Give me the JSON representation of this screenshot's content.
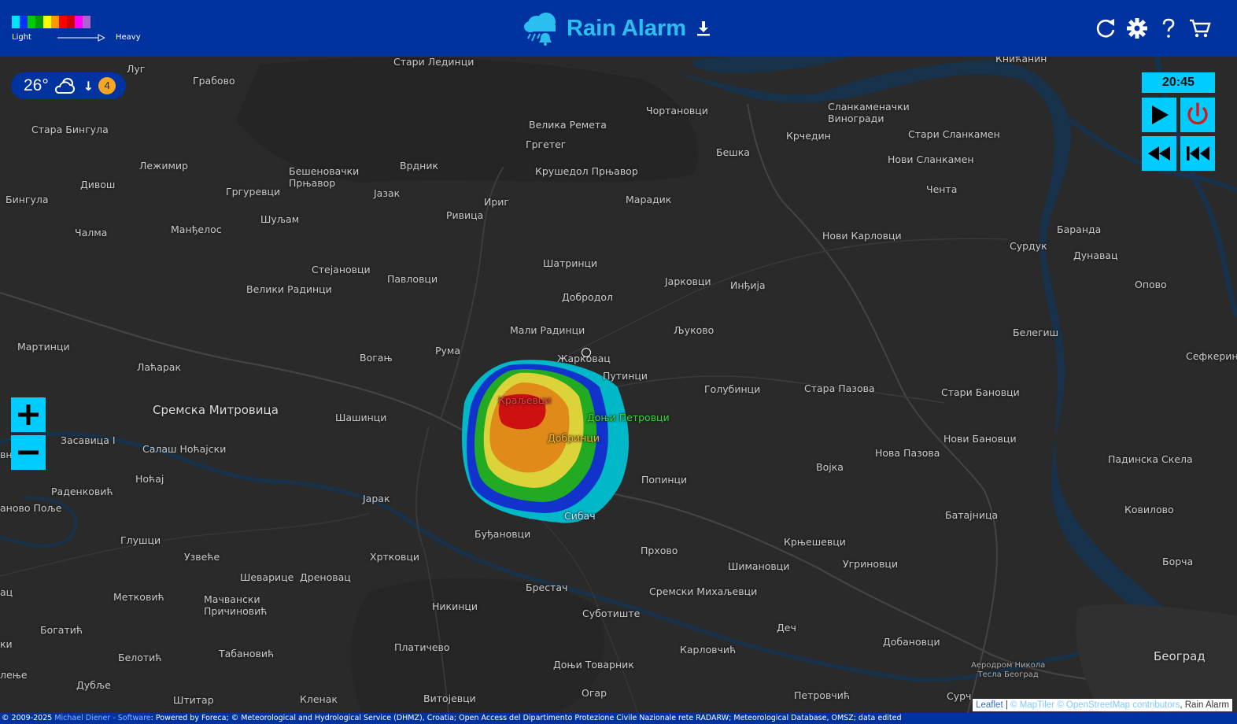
{
  "header": {
    "title": "Rain Alarm",
    "legend": {
      "light_label": "Light",
      "heavy_label": "Heavy",
      "colors": [
        "#00e5ff",
        "#0033ff",
        "#00cc00",
        "#009900",
        "#ffff00",
        "#ff9900",
        "#ff0000",
        "#cc0000",
        "#ff00ff",
        "#aa66cc"
      ]
    },
    "icons": [
      "rain-cloud-bell-icon",
      "download-icon",
      "refresh-icon",
      "gear-icon",
      "help-icon",
      "cart-icon"
    ]
  },
  "weather": {
    "temperature": "26°",
    "icon": "partly-cloudy-icon",
    "trend_icon": "down-arrow-icon",
    "badge": "4"
  },
  "player": {
    "time": "20:45",
    "buttons": [
      "play-icon",
      "power-icon",
      "rewind-icon",
      "skip-back-icon"
    ]
  },
  "zoom": {
    "in_icon": "plus-icon",
    "out_icon": "minus-icon"
  },
  "places": [
    {
      "name": "Луг"
    },
    {
      "name": "Грабово"
    },
    {
      "name": "Стари Лединци"
    },
    {
      "name": "Книћанин"
    },
    {
      "name": "Стара Бингула"
    },
    {
      "name": "Велика Ремета"
    },
    {
      "name": "Чортановци"
    },
    {
      "name": "Сланкаменачки\nВиногради"
    },
    {
      "name": "Гргетег"
    },
    {
      "name": "Бешка"
    },
    {
      "name": "Крчедин"
    },
    {
      "name": "Стари Сланкамен"
    },
    {
      "name": "Лежимир"
    },
    {
      "name": "Бешеновачки\nПрњавор"
    },
    {
      "name": "Врдник"
    },
    {
      "name": "Крушедол Прњавор"
    },
    {
      "name": "Нови Сланкамен"
    },
    {
      "name": "Дивош"
    },
    {
      "name": "Гргуревци"
    },
    {
      "name": "Јазак"
    },
    {
      "name": "Чента"
    },
    {
      "name": "Бингула"
    },
    {
      "name": "Ириг"
    },
    {
      "name": "Марадик"
    },
    {
      "name": "Ривица"
    },
    {
      "name": "Шуљам"
    },
    {
      "name": "Чалма"
    },
    {
      "name": "Манђелос"
    },
    {
      "name": "Баранда"
    },
    {
      "name": "Нови Карловци"
    },
    {
      "name": "Сурдук"
    },
    {
      "name": "Дунавац"
    },
    {
      "name": "Шатринци"
    },
    {
      "name": "Стејановци"
    },
    {
      "name": "Павловци"
    },
    {
      "name": "Велики Радинци"
    },
    {
      "name": "Јарковци"
    },
    {
      "name": "Инђија"
    },
    {
      "name": "Опово"
    },
    {
      "name": "Добродол"
    },
    {
      "name": "Мали Радинци"
    },
    {
      "name": "Љуково"
    },
    {
      "name": "Белегиш"
    },
    {
      "name": "Мартинци"
    },
    {
      "name": "Рума"
    },
    {
      "name": "Вогањ"
    },
    {
      "name": "Жарковац"
    },
    {
      "name": "Сефкерин"
    },
    {
      "name": "Лаћарак"
    },
    {
      "name": "Путинци"
    },
    {
      "name": "Голубинци"
    },
    {
      "name": "Стара Пазова"
    },
    {
      "name": "Стари Бановци"
    },
    {
      "name": "Сремска Митровица"
    },
    {
      "name": "Шашинци"
    },
    {
      "name": "Краљевци"
    },
    {
      "name": "Доњи Петровци"
    },
    {
      "name": "Добринци"
    },
    {
      "name": "Нови Бановци"
    },
    {
      "name": "Засавица I"
    },
    {
      "name": "Салаш Ноћајски"
    },
    {
      "name": "Нова Пазова"
    },
    {
      "name": "Падинска Скела"
    },
    {
      "name": "Ноћај"
    },
    {
      "name": "Војка"
    },
    {
      "name": "Попинци"
    },
    {
      "name": "Раденковић"
    },
    {
      "name": "Јарак"
    },
    {
      "name": "аново Поље"
    },
    {
      "name": "Ковилово"
    },
    {
      "name": "Сибач"
    },
    {
      "name": "Батајница"
    },
    {
      "name": "Буђановци"
    },
    {
      "name": "Глушци"
    },
    {
      "name": "Крњешевци"
    },
    {
      "name": "Прхово"
    },
    {
      "name": "Узвеће"
    },
    {
      "name": "Хртковци"
    },
    {
      "name": "Угриновци"
    },
    {
      "name": "Борча"
    },
    {
      "name": "Шимановци"
    },
    {
      "name": "Шеварице"
    },
    {
      "name": "Дреновац"
    },
    {
      "name": "ац"
    },
    {
      "name": "Брестач"
    },
    {
      "name": "Сремски Михаљевци"
    },
    {
      "name": "Метковић"
    },
    {
      "name": "Мачвански\nПричиновић"
    },
    {
      "name": "Никинци"
    },
    {
      "name": "Суботиште"
    },
    {
      "name": "Богатић"
    },
    {
      "name": "Деч"
    },
    {
      "name": "Добановци"
    },
    {
      "name": "ки"
    },
    {
      "name": "Платичево"
    },
    {
      "name": "Београд"
    },
    {
      "name": "Белотић"
    },
    {
      "name": "Табановић"
    },
    {
      "name": "Карловчић"
    },
    {
      "name": "Аеродром Никола\nТесла Београд"
    },
    {
      "name": "Доњи Товарник"
    },
    {
      "name": "лење"
    },
    {
      "name": "Дубље"
    },
    {
      "name": "Огар"
    },
    {
      "name": "Петровчић"
    },
    {
      "name": "Сурч"
    },
    {
      "name": "Штитар"
    },
    {
      "name": "Кленак"
    },
    {
      "name": "Витојевци"
    },
    {
      "name": "вна"
    }
  ],
  "attribution": {
    "leaflet": "Leaflet",
    "separator": " | ",
    "maptiler": "© MapTiler © OpenStreetMap contributors",
    "owner": ", Rain Alarm"
  },
  "footer": {
    "copyright": "© 2009-2025 ",
    "author": "Michael Diener - Software",
    "credits": ": Powered by Foreca; © Meteorological and Hydrological Service (DHMZ), Croatia; Open Access del Dipartimento Protezione Civile Nazionale rete RADARW; Meteorological Database, OMSZ; data edited"
  }
}
